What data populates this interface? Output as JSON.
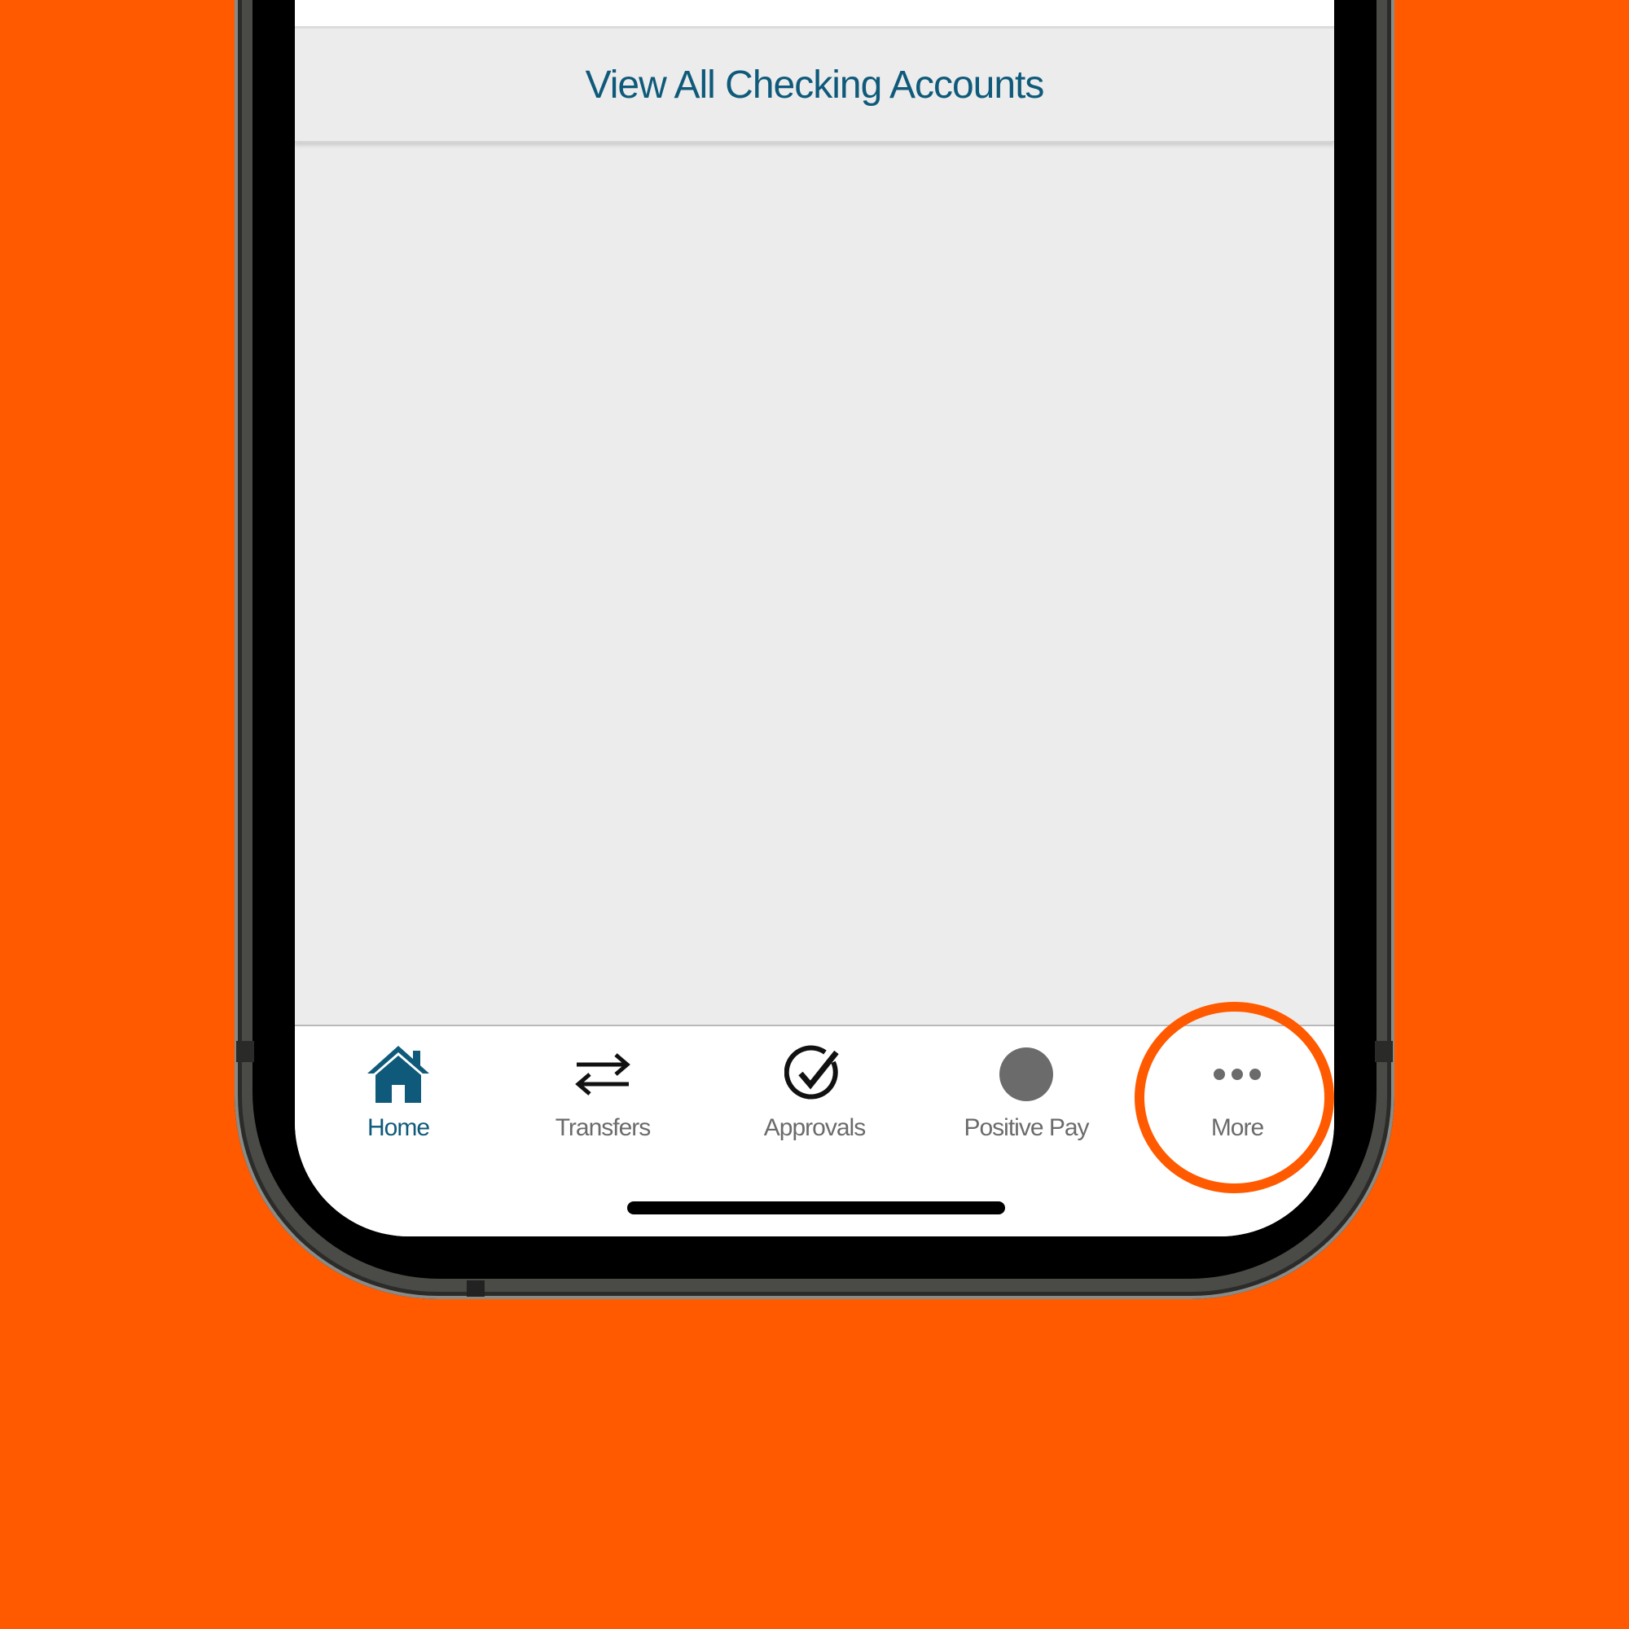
{
  "background_color": "#FF5A00",
  "accent_color": "#0F5A7A",
  "accounts_link": {
    "label": "View All Checking Accounts"
  },
  "tab_bar": {
    "tabs": [
      {
        "label": "Home",
        "icon": "home-icon",
        "active": true
      },
      {
        "label": "Transfers",
        "icon": "transfer-arrows-icon",
        "active": false
      },
      {
        "label": "Approvals",
        "icon": "check-circle-icon",
        "active": false
      },
      {
        "label": "Positive Pay",
        "icon": "filled-circle-icon",
        "active": false
      },
      {
        "label": "More",
        "icon": "more-dots-icon",
        "active": false
      }
    ]
  },
  "annotation": {
    "type": "highlight-circle",
    "target": "More",
    "color": "#FF5A00"
  }
}
